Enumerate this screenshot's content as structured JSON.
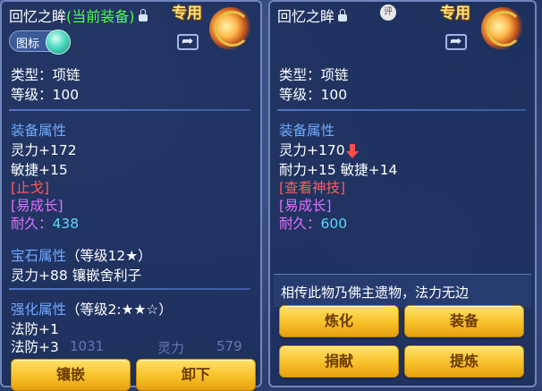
{
  "left": {
    "title": "回忆之眸",
    "current": "(当前装备)",
    "exclusive": "专用",
    "icon_toggle": "图标",
    "type": "类型：项链",
    "level": "等级：100",
    "section_attr": "装备属性",
    "attr1": "灵力+172",
    "attr2": "敏捷+15",
    "tag1": "[止戈]",
    "tag2": "[易成长]",
    "durability_label": "耐久：",
    "durability": "438",
    "gem_label": "宝石属性",
    "gem_level": "（等级12★）",
    "gem_line": "灵力+88 镶嵌舍利子",
    "enh_label": "强化属性",
    "enh_level": "（等级2:★★☆）",
    "enh1": "法防+1",
    "enh2": "法防+3",
    "btn_inlay": "镶嵌",
    "btn_unequip": "卸下"
  },
  "right": {
    "title": "回忆之眸",
    "badge": "评",
    "exclusive": "专用",
    "type": "类型：项链",
    "level": "等级：100",
    "section_attr": "装备属性",
    "attr1": "灵力+170",
    "attr2": "耐力+15 敏捷+14",
    "tag1": "[查看神技]",
    "tag2": "[易成长]",
    "durability_label": "耐久：",
    "durability": "600",
    "description": "相传此物乃佛主遗物，法力无边",
    "btn_refine": "炼化",
    "btn_equip": "装备",
    "btn_donate": "捐献",
    "btn_extract": "提炼"
  },
  "background_text": {
    "num1": "1031",
    "spirit": "灵力",
    "num2": "579"
  },
  "colors": {
    "current_green": "#4dff4d",
    "section_blue": "#6fa8ff",
    "tag_red": "#ff5a5a",
    "tag_pink": "#e070ff",
    "value_cyan": "#5ad8ff",
    "button_gold": "#f7c12a"
  }
}
